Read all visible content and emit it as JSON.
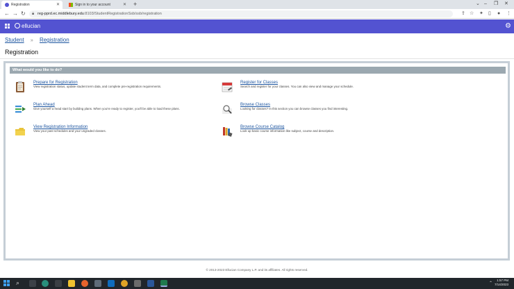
{
  "browser": {
    "tabs": [
      {
        "title": "Registration",
        "active": true
      },
      {
        "title": "Sign in to your account",
        "active": false
      }
    ],
    "url_domain": "reg-pprd.ec.middlebury.edu",
    "url_path": ":8103/StudentRegistrationSsb/ssb/registration"
  },
  "app": {
    "brand": "ellucian"
  },
  "breadcrumb": {
    "items": [
      "Student",
      "Registration"
    ],
    "separator": "»"
  },
  "page": {
    "title": "Registration"
  },
  "panel": {
    "header": "What would you like to do?",
    "options": [
      {
        "title": "Prepare for Registration",
        "desc": "View registration status, update student term data, and complete pre-registration requirements.",
        "icon": "clipboard-icon"
      },
      {
        "title": "Register for Classes",
        "desc": "Search and register for your classes. You can also view and manage your schedule.",
        "icon": "calendar-icon"
      },
      {
        "title": "Plan Ahead",
        "desc": "Give yourself a head start by building plans. When you're ready to register, you'll be able to load these plans.",
        "icon": "plan-list-icon"
      },
      {
        "title": "Browse Classes",
        "desc": "Looking for classes? In this section you can browse classes you find interesting.",
        "icon": "magnifier-icon"
      },
      {
        "title": "View Registration Information",
        "desc": "View your past schedules and your ungraded classes.",
        "icon": "folder-icon"
      },
      {
        "title": "Browse Course Catalog",
        "desc": "Look up basic course information like subject, course and description.",
        "icon": "books-icon"
      }
    ]
  },
  "footer": {
    "text": "© 2013-2023 Ellucian Company L.P. and its affiliates. All rights reserved."
  },
  "taskbar": {
    "time": "1:57 PM",
    "date": "7/14/2023"
  },
  "colors": {
    "appbar": "#5353d1",
    "link": "#1e56a0",
    "panel_header": "#9ba8b0",
    "panel_border": "#c5ced6"
  }
}
